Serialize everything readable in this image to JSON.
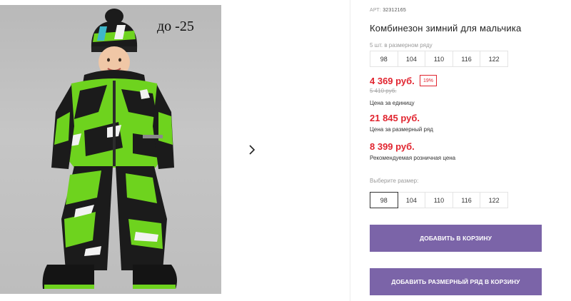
{
  "gallery": {
    "temperature_label": "до -25",
    "next_icon": "chevron-right-icon",
    "photo_colors": {
      "green": "#6ed31e",
      "black": "#1b1b1b",
      "white": "#f2f2f2",
      "background": "#c2c2c2"
    }
  },
  "product": {
    "article_prefix": "АРТ:",
    "article_code": "32312165",
    "title": "Комбинезон зимний для мальчика",
    "pack_label": "5 шт. в размерном ряду",
    "pack_sizes": [
      "98",
      "104",
      "110",
      "116",
      "122"
    ],
    "price": "4 369 руб.",
    "discount": "19%",
    "old_price": "5 410 руб.",
    "price_caption": "Цена за единицу",
    "pack_price": "21 845 руб.",
    "pack_price_caption": "Цена за размерный ряд",
    "rrp_price": "8 399 руб.",
    "rrp_caption": "Рекомендуемая розничная цена",
    "choose_label": "Выберите размер:",
    "choose_sizes": [
      "98",
      "104",
      "110",
      "116",
      "122"
    ],
    "selected_size": "98",
    "add_to_cart": "ДОБАВИТЬ В КОРЗИНУ",
    "add_pack_to_cart": "ДОБАВИТЬ РАЗМЕРНЫЙ РЯД В КОРЗИНУ",
    "colors": {
      "price_red": "#e1242f",
      "button_purple": "#7b64a8"
    }
  }
}
